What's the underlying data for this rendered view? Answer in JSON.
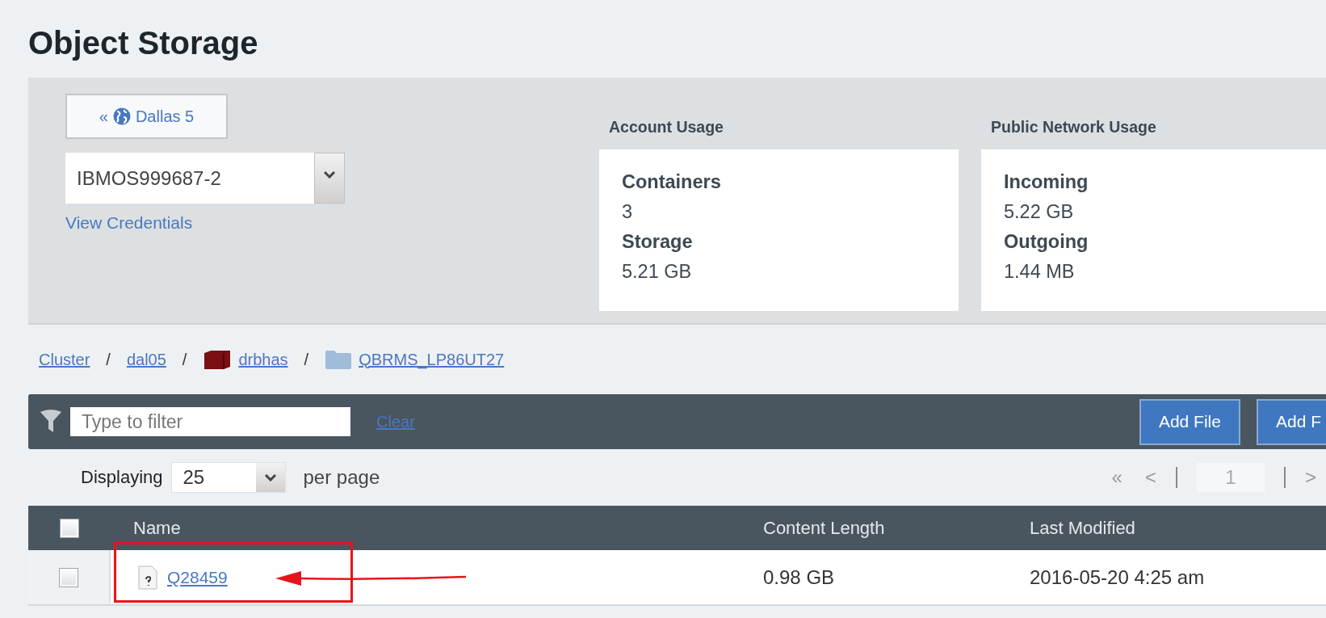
{
  "title": "Object Storage",
  "location": {
    "back": "«",
    "label": "Dallas 5"
  },
  "account_select": {
    "value": "IBMOS999687-2"
  },
  "view_credentials": "View Credentials",
  "usage_sections": [
    {
      "heading": "Account Usage",
      "stats": [
        {
          "label": "Containers",
          "value": "3"
        },
        {
          "label": "Storage",
          "value": "5.21 GB"
        }
      ]
    },
    {
      "heading": "Public Network Usage",
      "stats": [
        {
          "label": "Incoming",
          "value": "5.22 GB"
        },
        {
          "label": "Outgoing",
          "value": "1.44 MB"
        }
      ]
    }
  ],
  "breadcrumb": [
    {
      "label": "Cluster",
      "kind": "plain",
      "separator": "/"
    },
    {
      "label": "dal05",
      "kind": "plain",
      "separator": "/"
    },
    {
      "label": "drbhas",
      "kind": "container",
      "separator": "/"
    },
    {
      "label": "QBRMS_LP86UT27",
      "kind": "folder"
    }
  ],
  "filter": {
    "placeholder": "Type to filter"
  },
  "clear": "Clear",
  "buttons": [
    "Add File",
    "Add F"
  ],
  "paging": {
    "label": "Displaying",
    "per_page": "25",
    "suffix": "per page",
    "first": "«",
    "prev": "<",
    "page": "1",
    "next": ">"
  },
  "table": {
    "select_all": {
      "checked": false
    },
    "columns": [
      "Name",
      "Content Length",
      "Last Modified"
    ],
    "rows": [
      {
        "checked": false,
        "kind": "unknown-file",
        "name": "Q28459",
        "content_length": "0.98 GB",
        "last_modified": "2016-05-20 4:25 am"
      }
    ]
  },
  "annotation": {
    "kind": "callout"
  }
}
